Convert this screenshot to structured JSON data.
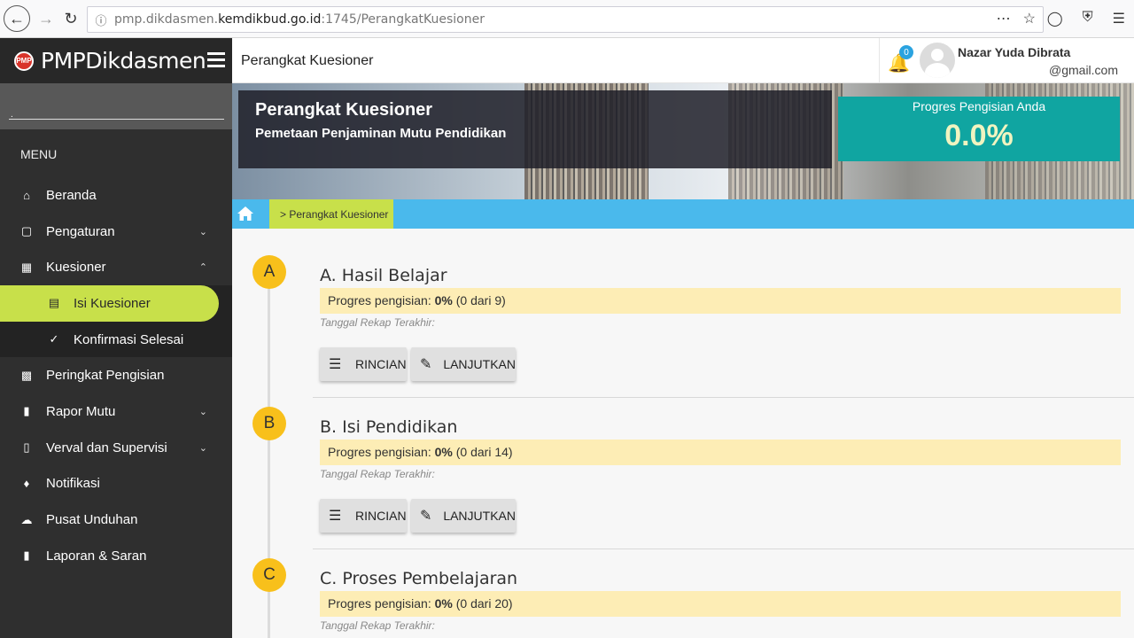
{
  "browser": {
    "url_prefix": "pmp.dikdasmen.",
    "url_domain": "kemdikbud.go.id",
    "url_suffix": ":1745/PerangkatKuesioner"
  },
  "brand": {
    "logo": "PMP",
    "name": "PMPDikdasmen"
  },
  "sidebar": {
    "menu_label": "MENU",
    "items": [
      {
        "label": "Beranda",
        "icon": "home-icon"
      },
      {
        "label": "Pengaturan",
        "icon": "monitor-icon"
      },
      {
        "label": "Kuesioner",
        "icon": "questionnaire-icon"
      },
      {
        "label": "Isi Kuesioner",
        "icon": "form-icon"
      },
      {
        "label": "Konfirmasi Selesai",
        "icon": "check-circle-icon"
      },
      {
        "label": "Peringkat Pengisian",
        "icon": "chart-icon"
      },
      {
        "label": "Rapor Mutu",
        "icon": "book-icon"
      },
      {
        "label": "Verval dan Supervisi",
        "icon": "book-check-icon"
      },
      {
        "label": "Notifikasi",
        "icon": "bell-icon"
      },
      {
        "label": "Pusat Unduhan",
        "icon": "cloud-download-icon"
      },
      {
        "label": "Laporan & Saran",
        "icon": "report-icon"
      }
    ]
  },
  "header": {
    "title": "Perangkat Kuesioner",
    "notif_count": "0",
    "user_name": "Nazar Yuda Dibrata",
    "user_email": "@gmail.com"
  },
  "banner": {
    "title": "Perangkat Kuesioner",
    "subtitle": "Pemetaan Penjaminan Mutu Pendidikan",
    "progress_label": "Progres Pengisian Anda",
    "progress_value": "0.0%"
  },
  "breadcrumb": {
    "current": "> Perangkat Kuesioner"
  },
  "sections": [
    {
      "letter": "A",
      "title": "A. Hasil Belajar",
      "progress_label": "Progres pengisian:",
      "progress_pct": "0%",
      "progress_detail": "(0 dari 9)",
      "rekap": "Tanggal Rekap Terakhir:",
      "btn_rincian": "RINCIAN",
      "btn_lanjutkan": "LANJUTKAN"
    },
    {
      "letter": "B",
      "title": "B. Isi Pendidikan",
      "progress_label": "Progres pengisian:",
      "progress_pct": "0%",
      "progress_detail": "(0 dari 14)",
      "rekap": "Tanggal Rekap Terakhir:",
      "btn_rincian": "RINCIAN",
      "btn_lanjutkan": "LANJUTKAN"
    },
    {
      "letter": "C",
      "title": "C. Proses Pembelajaran",
      "progress_label": "Progres pengisian:",
      "progress_pct": "0%",
      "progress_detail": "(0 dari 20)",
      "rekap": "Tanggal Rekap Terakhir:"
    }
  ]
}
